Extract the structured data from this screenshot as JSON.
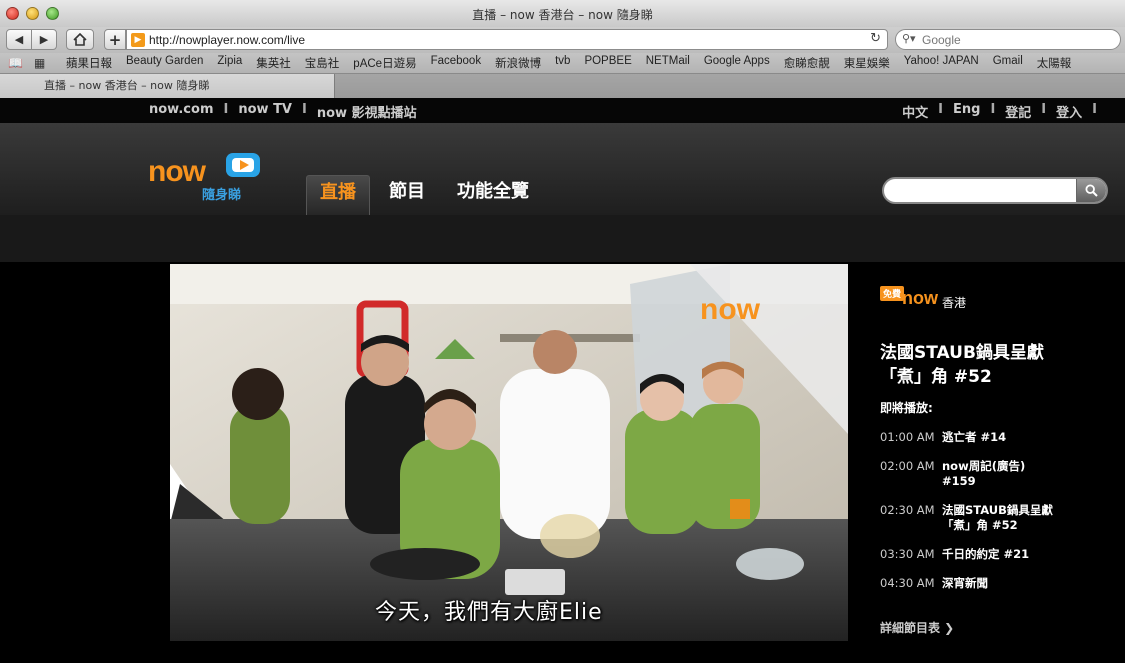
{
  "browser": {
    "window_title": "直播 – now 香港台 – now 隨身睇",
    "url": "http://nowplayer.now.com/live",
    "search_placeholder": "Google",
    "bookmarks": [
      "蘋果日報",
      "Beauty Garden",
      "Zipia",
      "集英社",
      "宝島社",
      "pACe日遊易",
      "Facebook",
      "新浪微博",
      "tvb",
      "POPBEE",
      "NETMail",
      "Google Apps",
      "愈睇愈靚",
      "東星娛樂",
      "Yahoo! JAPAN",
      "Gmail",
      "太陽報"
    ],
    "tab_title": "直播 – now 香港台 – now 隨身睇"
  },
  "site": {
    "topnav_left": [
      "now.com",
      "now TV",
      "now 影視點播站"
    ],
    "topnav_right": [
      "中文",
      "Eng",
      "登記",
      "登入"
    ],
    "logo_text": "now",
    "logo_sub": "隨身睇",
    "mainnav": [
      "直播",
      "節目",
      "功能全覽"
    ],
    "search_placeholder": ""
  },
  "video": {
    "subtitle": "今天，我們有大廚Elie",
    "watermark": "now香港"
  },
  "sidebar": {
    "free_badge": "免費",
    "channel_logo": "now",
    "channel_logo_sub": "香港",
    "now_playing": "法國STAUB鍋具呈獻「煮」角 #52",
    "up_next_label": "即將播放:",
    "schedule": [
      {
        "time": "01:00 AM",
        "show": "逃亡者 #14"
      },
      {
        "time": "02:00 AM",
        "show": "now周記(廣告) #159"
      },
      {
        "time": "02:30 AM",
        "show": "法國STAUB鍋具呈獻「煮」角 #52"
      },
      {
        "time": "03:30 AM",
        "show": "千日的約定 #21"
      },
      {
        "time": "04:30 AM",
        "show": "深宵新聞"
      }
    ],
    "full_schedule": "詳細節目表 ❯"
  }
}
